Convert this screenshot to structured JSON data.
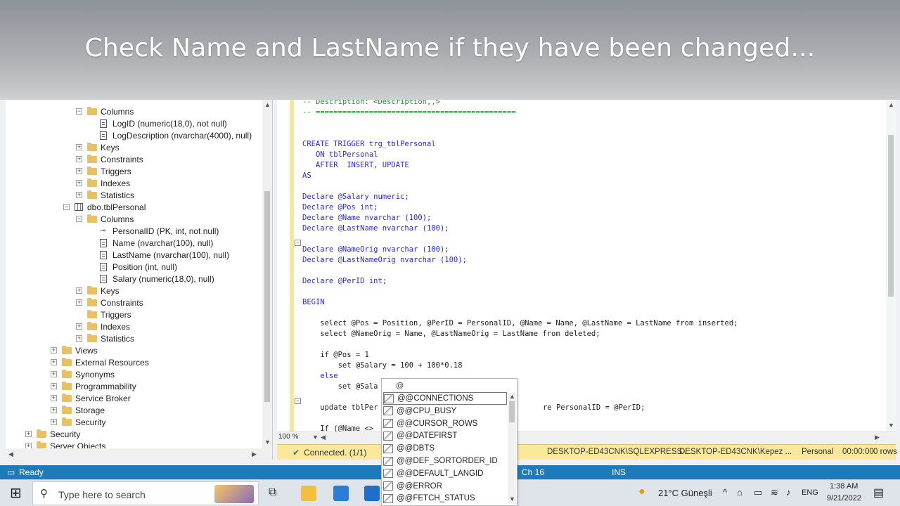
{
  "banner": {
    "caption": "Check Name and LastName if they have been changed..."
  },
  "explorer": {
    "items": [
      {
        "label": "Columns",
        "kind": "folder",
        "exp": "−"
      },
      {
        "label": "LogID (numeric(18,0), not null)",
        "kind": "column"
      },
      {
        "label": "LogDescription (nvarchar(4000), null)",
        "kind": "column"
      },
      {
        "label": "Keys",
        "kind": "folder",
        "exp": "+"
      },
      {
        "label": "Constraints",
        "kind": "folder",
        "exp": "+"
      },
      {
        "label": "Triggers",
        "kind": "folder",
        "exp": "+"
      },
      {
        "label": "Indexes",
        "kind": "folder",
        "exp": "+"
      },
      {
        "label": "Statistics",
        "kind": "folder",
        "exp": "+"
      },
      {
        "label": "dbo.tblPersonal",
        "kind": "table",
        "exp": "−"
      },
      {
        "label": "Columns",
        "kind": "folder",
        "exp": "−"
      },
      {
        "label": "PersonalID (PK, int, not null)",
        "kind": "key"
      },
      {
        "label": "Name (nvarchar(100), null)",
        "kind": "column"
      },
      {
        "label": "LastName (nvarchar(100), null)",
        "kind": "column"
      },
      {
        "label": "Position (int, null)",
        "kind": "column"
      },
      {
        "label": "Salary (numeric(18,0), null)",
        "kind": "column"
      },
      {
        "label": "Keys",
        "kind": "folder",
        "exp": "+"
      },
      {
        "label": "Constraints",
        "kind": "folder",
        "exp": "+"
      },
      {
        "label": "Triggers",
        "kind": "folder",
        "exp": ""
      },
      {
        "label": "Indexes",
        "kind": "folder",
        "exp": "+"
      },
      {
        "label": "Statistics",
        "kind": "folder",
        "exp": "+"
      },
      {
        "label": "Views",
        "kind": "folder",
        "exp": "+"
      },
      {
        "label": "External Resources",
        "kind": "folder",
        "exp": "+"
      },
      {
        "label": "Synonyms",
        "kind": "folder",
        "exp": "+"
      },
      {
        "label": "Programmability",
        "kind": "folder",
        "exp": "+"
      },
      {
        "label": "Service Broker",
        "kind": "folder",
        "exp": "+"
      },
      {
        "label": "Storage",
        "kind": "folder",
        "exp": "+"
      },
      {
        "label": "Security",
        "kind": "folder",
        "exp": "+"
      },
      {
        "label": "Security",
        "kind": "folder",
        "exp": "+"
      },
      {
        "label": "Server Objects",
        "kind": "folder",
        "exp": "+"
      }
    ]
  },
  "editor": {
    "lines": [
      {
        "t": "-- Description: <Description,,>",
        "c": "cm"
      },
      {
        "t": "-- =============================================",
        "c": "cm"
      },
      {
        "t": "",
        "c": "pl"
      },
      {
        "t": "",
        "c": "pl"
      },
      {
        "t": "CREATE TRIGGER trg_tblPersonal",
        "c": "kw"
      },
      {
        "t": "   ON tblPersonal",
        "c": "kw"
      },
      {
        "t": "   AFTER  INSERT, UPDATE",
        "c": "kw"
      },
      {
        "t": "AS",
        "c": "kw"
      },
      {
        "t": "",
        "c": "pl"
      },
      {
        "t": "Declare @Salary numeric;",
        "c": "kw"
      },
      {
        "t": "Declare @Pos int;",
        "c": "kw"
      },
      {
        "t": "Declare @Name nvarchar (100);",
        "c": "kw"
      },
      {
        "t": "Declare @LastName nvarchar (100);",
        "c": "kw"
      },
      {
        "t": "",
        "c": "pl"
      },
      {
        "t": "Declare @NameOrig nvarchar (100);",
        "c": "kw"
      },
      {
        "t": "Declare @LastNameOrig nvarchar (100);",
        "c": "kw"
      },
      {
        "t": "",
        "c": "pl"
      },
      {
        "t": "Declare @PerID int;",
        "c": "kw"
      },
      {
        "t": "",
        "c": "pl"
      },
      {
        "t": "BEGIN",
        "c": "kw"
      },
      {
        "t": "",
        "c": "pl"
      },
      {
        "t": "    select @Pos = Position, @PerID = PersonalID, @Name = Name, @LastName = LastName from inserted;",
        "c": "pl"
      },
      {
        "t": "    select @NameOrig = Name, @LastNameOrig = LastName from deleted;",
        "c": "pl"
      },
      {
        "t": "",
        "c": "pl"
      },
      {
        "t": "    if @Pos = 1",
        "c": "pl"
      },
      {
        "t": "        set @Salary = 100 + 100*0.18",
        "c": "pl"
      },
      {
        "t": "    else",
        "c": "kw"
      },
      {
        "t": "        set @Sala",
        "c": "pl"
      },
      {
        "t": "",
        "c": "pl"
      },
      {
        "t": "    update tblPer",
        "c": "pl"
      },
      {
        "t": "",
        "c": "pl"
      },
      {
        "t": "    If (@Name <>",
        "c": "pl"
      }
    ],
    "update_tail": "re PersonalID = @PerID;",
    "zoom": "100 %"
  },
  "statusbar": {
    "connected": "Connected. (1/1)",
    "server": "DESKTOP-ED43CNK\\SQLEXPRESS ...",
    "user": "DESKTOP-ED43CNK\\Kepez ...",
    "db": "Personal",
    "time": "00:00:00",
    "rows": "0 rows"
  },
  "appstatus": {
    "ready": "Ready",
    "col": "Ch 16",
    "mode": "INS"
  },
  "autocomplete": {
    "typed": "@",
    "items": [
      "@@CONNECTIONS",
      "@@CPU_BUSY",
      "@@CURSOR_ROWS",
      "@@DATEFIRST",
      "@@DBTS",
      "@@DEF_SORTORDER_ID",
      "@@DEFAULT_LANGID",
      "@@ERROR",
      "@@FETCH_STATUS"
    ]
  },
  "taskbar": {
    "search_placeholder": "Type here to search",
    "weather": "21°C Güneşli",
    "lang": "ENG",
    "time": "1:38 AM",
    "date": "9/21/2022"
  }
}
